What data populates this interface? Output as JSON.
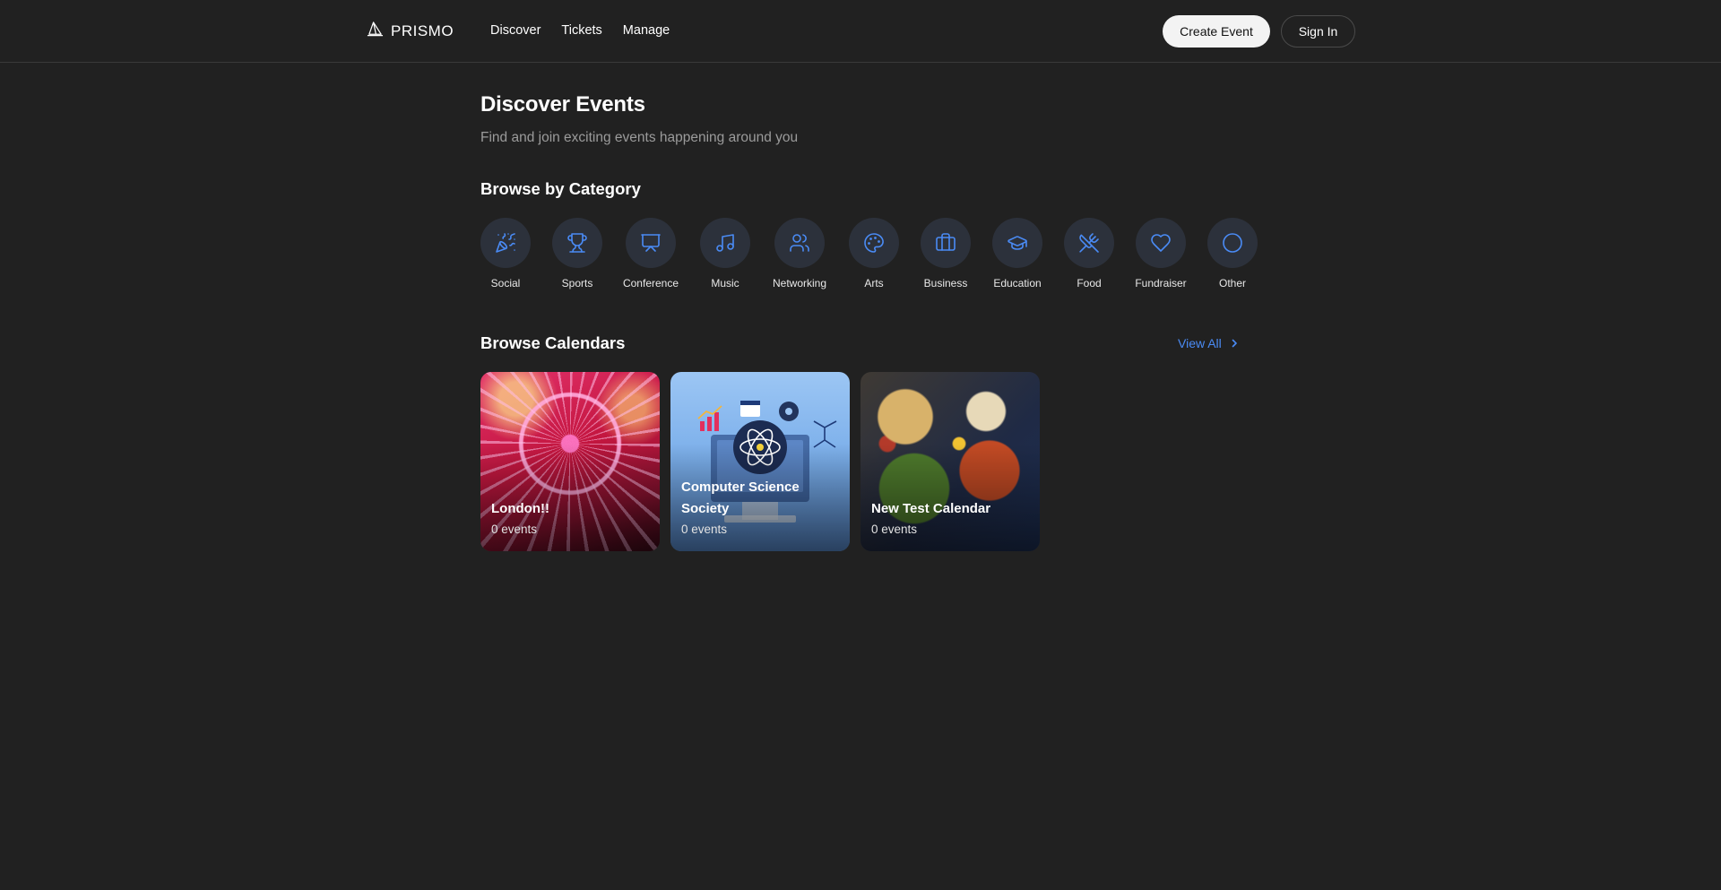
{
  "header": {
    "logo_text": "PRISMO",
    "nav": [
      "Discover",
      "Tickets",
      "Manage"
    ],
    "create_event": "Create Event",
    "sign_in": "Sign In"
  },
  "main": {
    "title": "Discover Events",
    "subtitle": "Find and join exciting events happening around you",
    "browse_category_title": "Browse by Category",
    "categories": [
      {
        "label": "Social",
        "icon": "party-popper-icon"
      },
      {
        "label": "Sports",
        "icon": "trophy-icon"
      },
      {
        "label": "Conference",
        "icon": "presentation-icon"
      },
      {
        "label": "Music",
        "icon": "music-note-icon"
      },
      {
        "label": "Networking",
        "icon": "users-icon"
      },
      {
        "label": "Arts",
        "icon": "palette-icon"
      },
      {
        "label": "Business",
        "icon": "briefcase-icon"
      },
      {
        "label": "Education",
        "icon": "graduation-cap-icon"
      },
      {
        "label": "Food",
        "icon": "utensils-icon"
      },
      {
        "label": "Fundraiser",
        "icon": "heart-icon"
      },
      {
        "label": "Other",
        "icon": "circle-icon"
      }
    ],
    "browse_calendars_title": "Browse Calendars",
    "view_all": "View All",
    "calendars": [
      {
        "title": "London!!",
        "count": "0 events"
      },
      {
        "title": "Computer Science Society",
        "count": "0 events"
      },
      {
        "title": "New Test Calendar",
        "count": "0 events"
      }
    ]
  },
  "colors": {
    "background": "#212121",
    "accent": "#4a8bf5",
    "category_circle": "#2c313b"
  }
}
